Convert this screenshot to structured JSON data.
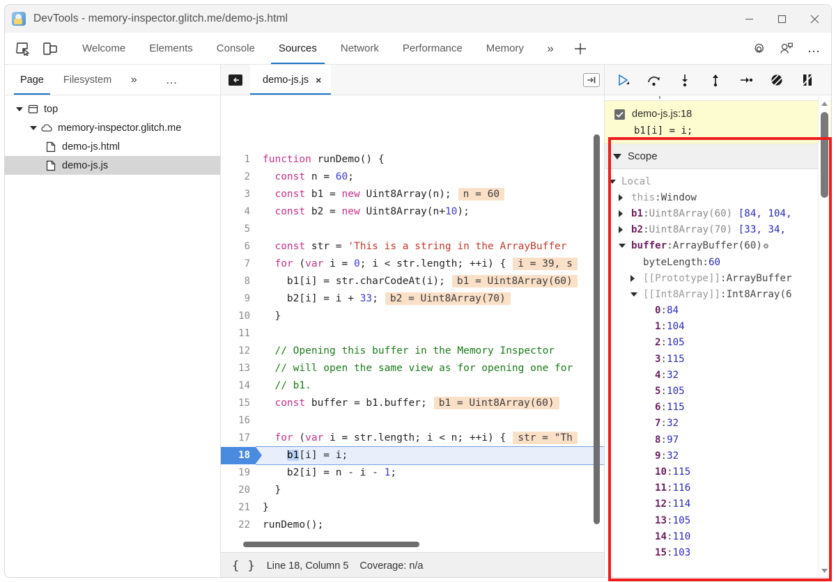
{
  "window": {
    "title": "DevTools - memory-inspector.glitch.me/demo-js.html",
    "logo_icon": "devtools-logo-icon",
    "minimize_icon": "minimize-icon",
    "maximize_icon": "maximize-icon",
    "close_icon": "close-icon"
  },
  "toolbar": {
    "inspect_icon": "inspect-element-icon",
    "device_icon": "device-toolbar-icon",
    "tabs": [
      {
        "label": "Welcome",
        "active": false
      },
      {
        "label": "Elements",
        "active": false
      },
      {
        "label": "Console",
        "active": false
      },
      {
        "label": "Sources",
        "active": true
      },
      {
        "label": "Network",
        "active": false
      },
      {
        "label": "Performance",
        "active": false
      },
      {
        "label": "Memory",
        "active": false
      }
    ],
    "more_tabs_glyph": "»",
    "add_tab_glyph": "+",
    "settings_icon": "gear-icon",
    "feedback_icon": "feedback-icon",
    "more_glyph": "…"
  },
  "navigator": {
    "tabs": [
      {
        "label": "Page",
        "active": true
      },
      {
        "label": "Filesystem",
        "active": false
      }
    ],
    "more_glyph": "»",
    "dots_glyph": "…",
    "tree": [
      {
        "label": "top",
        "icon": "frame-icon",
        "expanded": true,
        "indent": 1,
        "selected": false
      },
      {
        "label": "memory-inspector.glitch.me",
        "icon": "cloud-icon",
        "expanded": true,
        "indent": 2,
        "selected": false
      },
      {
        "label": "demo-js.html",
        "icon": "file-icon",
        "expanded": null,
        "indent": 3,
        "selected": false
      },
      {
        "label": "demo-js.js",
        "icon": "file-icon",
        "expanded": null,
        "indent": 3,
        "selected": true
      }
    ]
  },
  "editor": {
    "panel_toggle_icon": "show-navigator-icon",
    "tab_label": "demo-js.js",
    "tab_close_glyph": "×",
    "popout_icon": "open-in-new-panel-icon",
    "lines": [
      {
        "n": 1,
        "tokens": [
          {
            "t": "kw",
            "v": "function"
          },
          {
            "t": "pln",
            "v": " runDemo() {"
          }
        ]
      },
      {
        "n": 2,
        "tokens": [
          {
            "t": "pln",
            "v": "  "
          },
          {
            "t": "kw",
            "v": "const"
          },
          {
            "t": "pln",
            "v": " n = "
          },
          {
            "t": "num",
            "v": "60"
          },
          {
            "t": "pln",
            "v": ";"
          }
        ]
      },
      {
        "n": 3,
        "tokens": [
          {
            "t": "pln",
            "v": "  "
          },
          {
            "t": "kw",
            "v": "const"
          },
          {
            "t": "pln",
            "v": " b1 = "
          },
          {
            "t": "kw",
            "v": "new"
          },
          {
            "t": "pln",
            "v": " Uint8Array(n);"
          }
        ],
        "hint": "n = 60"
      },
      {
        "n": 4,
        "tokens": [
          {
            "t": "pln",
            "v": "  "
          },
          {
            "t": "kw",
            "v": "const"
          },
          {
            "t": "pln",
            "v": " b2 = "
          },
          {
            "t": "kw",
            "v": "new"
          },
          {
            "t": "pln",
            "v": " Uint8Array(n+"
          },
          {
            "t": "num",
            "v": "10"
          },
          {
            "t": "pln",
            "v": ");"
          }
        ]
      },
      {
        "n": 5,
        "tokens": []
      },
      {
        "n": 6,
        "tokens": [
          {
            "t": "pln",
            "v": "  "
          },
          {
            "t": "kw",
            "v": "const"
          },
          {
            "t": "pln",
            "v": " str = "
          },
          {
            "t": "str",
            "v": "'This is a string in the ArrayBuffer"
          }
        ]
      },
      {
        "n": 7,
        "tokens": [
          {
            "t": "pln",
            "v": "  "
          },
          {
            "t": "kw",
            "v": "for"
          },
          {
            "t": "pln",
            "v": " ("
          },
          {
            "t": "kw",
            "v": "var"
          },
          {
            "t": "pln",
            "v": " i = "
          },
          {
            "t": "num",
            "v": "0"
          },
          {
            "t": "pln",
            "v": "; i < str.length; ++i) {"
          }
        ],
        "hint": "i = 39, s"
      },
      {
        "n": 8,
        "tokens": [
          {
            "t": "pln",
            "v": "    b1[i] = str.charCodeAt(i);"
          }
        ],
        "hint": "b1 = Uint8Array(60)"
      },
      {
        "n": 9,
        "tokens": [
          {
            "t": "pln",
            "v": "    b2[i] = i + "
          },
          {
            "t": "num",
            "v": "33"
          },
          {
            "t": "pln",
            "v": ";"
          }
        ],
        "hint": "b2 = Uint8Array(70)"
      },
      {
        "n": 10,
        "tokens": [
          {
            "t": "pln",
            "v": "  }"
          }
        ]
      },
      {
        "n": 11,
        "tokens": []
      },
      {
        "n": 12,
        "tokens": [
          {
            "t": "pln",
            "v": "  "
          },
          {
            "t": "cmt",
            "v": "// Opening this buffer in the Memory Inspector"
          }
        ]
      },
      {
        "n": 13,
        "tokens": [
          {
            "t": "pln",
            "v": "  "
          },
          {
            "t": "cmt",
            "v": "// will open the same view as for opening one for"
          }
        ]
      },
      {
        "n": 14,
        "tokens": [
          {
            "t": "pln",
            "v": "  "
          },
          {
            "t": "cmt",
            "v": "// b1."
          }
        ]
      },
      {
        "n": 15,
        "tokens": [
          {
            "t": "pln",
            "v": "  "
          },
          {
            "t": "kw",
            "v": "const"
          },
          {
            "t": "pln",
            "v": " buffer = b1.buffer;"
          }
        ],
        "hint": "b1 = Uint8Array(60)"
      },
      {
        "n": 16,
        "tokens": []
      },
      {
        "n": 17,
        "tokens": [
          {
            "t": "pln",
            "v": "  "
          },
          {
            "t": "kw",
            "v": "for"
          },
          {
            "t": "pln",
            "v": " ("
          },
          {
            "t": "kw",
            "v": "var"
          },
          {
            "t": "pln",
            "v": " i = str.length; i < n; ++i) {"
          }
        ],
        "hint": "str = \"Th"
      },
      {
        "n": 18,
        "tokens": [
          {
            "t": "pln",
            "v": "    "
          },
          {
            "t": "hl",
            "v": "b1"
          },
          {
            "t": "pln",
            "v": "[i] = i;"
          }
        ],
        "current": true
      },
      {
        "n": 19,
        "tokens": [
          {
            "t": "pln",
            "v": "    b2[i] = n - i - "
          },
          {
            "t": "num",
            "v": "1"
          },
          {
            "t": "pln",
            "v": ";"
          }
        ]
      },
      {
        "n": 20,
        "tokens": [
          {
            "t": "pln",
            "v": "  }"
          }
        ]
      },
      {
        "n": 21,
        "tokens": [
          {
            "t": "pln",
            "v": "}"
          }
        ]
      },
      {
        "n": 22,
        "tokens": [
          {
            "t": "pln",
            "v": "runDemo();"
          }
        ]
      }
    ]
  },
  "statusbar": {
    "pretty_print_glyph": "{ }",
    "position": "Line 18, Column 5",
    "coverage": "Coverage: n/a"
  },
  "debugger": {
    "buttons": [
      {
        "name": "resume-script-button",
        "icon": "resume-icon"
      },
      {
        "name": "step-over-button",
        "icon": "step-over-icon"
      },
      {
        "name": "step-into-button",
        "icon": "step-into-icon"
      },
      {
        "name": "step-out-button",
        "icon": "step-out-icon"
      },
      {
        "name": "step-button",
        "icon": "step-icon"
      },
      {
        "name": "deactivate-breakpoints-button",
        "icon": "deactivate-breakpoints-icon"
      },
      {
        "name": "pause-on-exceptions-button",
        "icon": "pause-on-exceptions-icon"
      }
    ],
    "breakpoint": {
      "location": "demo-js.js:18",
      "snippet": "b1[i] = i;",
      "checked": true
    },
    "scope": {
      "title": "Scope",
      "rows": [
        {
          "indent": 0,
          "twisty": "down",
          "name": "Local",
          "name_style": "grey",
          "value": "",
          "value_style": ""
        },
        {
          "indent": 1,
          "twisty": "right",
          "name": "this",
          "name_style": "grey",
          "value": "Window",
          "value_style": "plain"
        },
        {
          "indent": 1,
          "twisty": "right",
          "name": "b1",
          "name_style": "bold",
          "value": "Uint8Array(60) [84, 104,",
          "value_style": "mixed"
        },
        {
          "indent": 1,
          "twisty": "right",
          "name": "b2",
          "name_style": "bold",
          "value": "Uint8Array(70) [33, 34,",
          "value_style": "mixed"
        },
        {
          "indent": 1,
          "twisty": "down",
          "name": "buffer",
          "name_style": "bold",
          "value": "ArrayBuffer(60)",
          "value_style": "plain",
          "gear": true
        },
        {
          "indent": 2,
          "twisty": "none",
          "name": "byteLength",
          "name_style": "plain",
          "value": "60",
          "value_style": "num"
        },
        {
          "indent": 2,
          "twisty": "right",
          "name": "[[Prototype]]",
          "name_style": "proto",
          "value": "ArrayBuffer",
          "value_style": "plain"
        },
        {
          "indent": 2,
          "twisty": "down",
          "name": "[[Int8Array]]",
          "name_style": "proto",
          "value": "Int8Array(6",
          "value_style": "plain"
        },
        {
          "indent": 3,
          "twisty": "none",
          "name": "0",
          "name_style": "key",
          "value": "84",
          "value_style": "num"
        },
        {
          "indent": 3,
          "twisty": "none",
          "name": "1",
          "name_style": "key",
          "value": "104",
          "value_style": "num"
        },
        {
          "indent": 3,
          "twisty": "none",
          "name": "2",
          "name_style": "key",
          "value": "105",
          "value_style": "num"
        },
        {
          "indent": 3,
          "twisty": "none",
          "name": "3",
          "name_style": "key",
          "value": "115",
          "value_style": "num"
        },
        {
          "indent": 3,
          "twisty": "none",
          "name": "4",
          "name_style": "key",
          "value": "32",
          "value_style": "num"
        },
        {
          "indent": 3,
          "twisty": "none",
          "name": "5",
          "name_style": "key",
          "value": "105",
          "value_style": "num"
        },
        {
          "indent": 3,
          "twisty": "none",
          "name": "6",
          "name_style": "key",
          "value": "115",
          "value_style": "num"
        },
        {
          "indent": 3,
          "twisty": "none",
          "name": "7",
          "name_style": "key",
          "value": "32",
          "value_style": "num"
        },
        {
          "indent": 3,
          "twisty": "none",
          "name": "8",
          "name_style": "key",
          "value": "97",
          "value_style": "num"
        },
        {
          "indent": 3,
          "twisty": "none",
          "name": "9",
          "name_style": "key",
          "value": "32",
          "value_style": "num"
        },
        {
          "indent": 3,
          "twisty": "none",
          "name": "10",
          "name_style": "key",
          "value": "115",
          "value_style": "num"
        },
        {
          "indent": 3,
          "twisty": "none",
          "name": "11",
          "name_style": "key",
          "value": "116",
          "value_style": "num"
        },
        {
          "indent": 3,
          "twisty": "none",
          "name": "12",
          "name_style": "key",
          "value": "114",
          "value_style": "num"
        },
        {
          "indent": 3,
          "twisty": "none",
          "name": "13",
          "name_style": "key",
          "value": "105",
          "value_style": "num"
        },
        {
          "indent": 3,
          "twisty": "none",
          "name": "14",
          "name_style": "key",
          "value": "110",
          "value_style": "num"
        },
        {
          "indent": 3,
          "twisty": "none",
          "name": "15",
          "name_style": "key",
          "value": "103",
          "value_style": "num"
        }
      ]
    },
    "scrollbar": {
      "up_glyph": "▲",
      "down_glyph": "▼"
    }
  },
  "annotation": {
    "highlight_color": "#ee1c1c"
  }
}
